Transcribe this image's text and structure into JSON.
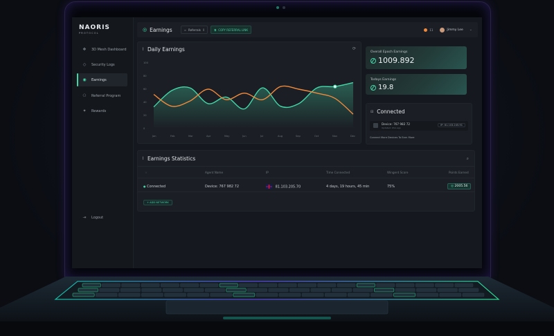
{
  "brand": {
    "name": "NAORIS",
    "tagline": "PROTOCOL"
  },
  "sidebar": {
    "items": [
      {
        "label": "3D Mesh Dashboard",
        "icon": "cube-icon"
      },
      {
        "label": "Security Logs",
        "icon": "shield-icon"
      },
      {
        "label": "Earnings",
        "icon": "eye-icon",
        "active": true
      },
      {
        "label": "Referral Program",
        "icon": "users-icon"
      },
      {
        "label": "Rewards",
        "icon": "gift-icon"
      }
    ],
    "logout": "Logout"
  },
  "header": {
    "title": "Earnings",
    "referrals_label": "Referrals",
    "referrals_count": "0",
    "copy_label": "COPY REFERRAL LINK",
    "notif_count": "11",
    "user_name": "Jimmy Lee"
  },
  "daily_chart": {
    "title": "Daily Earnings",
    "chart_data": {
      "type": "line",
      "title": "Daily Earnings",
      "xlabel": "",
      "ylabel": "",
      "categories": [
        "Jan",
        "Feb",
        "Mar",
        "Apr",
        "May",
        "Jun",
        "Jul",
        "Aug",
        "Sep",
        "Oct",
        "Nov",
        "Dec"
      ],
      "yticks": [
        "0",
        "20",
        "40",
        "60",
        "80",
        "100"
      ],
      "ylim": [
        0,
        100
      ],
      "grid": false,
      "series": [
        {
          "color": "#45d6a8",
          "values": [
            33,
            58,
            62,
            38,
            48,
            30,
            62,
            34,
            38,
            62,
            64,
            70
          ],
          "area": true
        },
        {
          "color": "#f08a3c",
          "values": [
            52,
            34,
            42,
            60,
            44,
            54,
            44,
            64,
            60,
            54,
            46,
            22
          ]
        }
      ],
      "highlight": {
        "series": 0,
        "index": 10
      }
    }
  },
  "stats": {
    "overall_label": "Overall Epoch Earnings",
    "overall_value": "1009.892",
    "today_label": "Todays Earnings",
    "today_value": "19.8"
  },
  "connected": {
    "title": "Connected",
    "device_label": "Device: 767 982 72",
    "device_sub": "Updated: 4hrs ago",
    "ip": "IP: 81.103.245.91",
    "footer": "Connect More Devices To Earn More"
  },
  "statistics": {
    "title": "Earnings Statistics",
    "columns": [
      "",
      "Agent Name",
      "IP",
      "Time Connected",
      "Wingent Score",
      "Points Earned"
    ],
    "rows": [
      {
        "status": "Connected",
        "agent": "Device: 767 982 72",
        "ip": "81.103.205.70",
        "time": "4 days, 19 hours, 45 min",
        "score": "75%",
        "points": "2005.56"
      }
    ],
    "add_button": "ADD NETWORK"
  },
  "colors": {
    "accent": "#45d6a8",
    "orange": "#f08a3c",
    "glow": "#5b3de0"
  }
}
